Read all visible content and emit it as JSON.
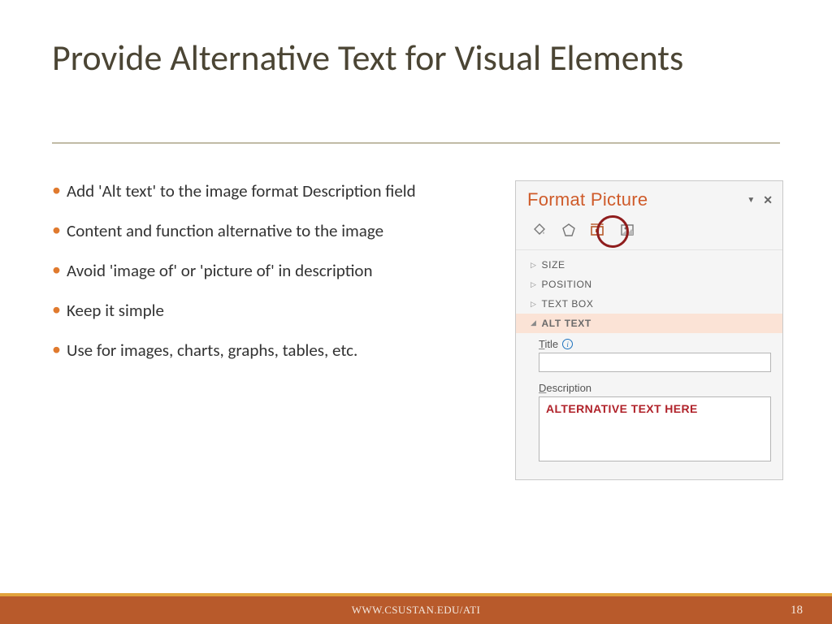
{
  "title": "Provide Alternative Text for Visual Elements",
  "bullets": [
    "Add 'Alt text' to the image format Description field",
    "Content and function alternative to the image",
    "Avoid 'image of' or 'picture of' in description",
    "Keep it simple",
    "Use for images, charts, graphs, tables, etc."
  ],
  "panel": {
    "title": "Format Picture",
    "sections": {
      "size": "SIZE",
      "position": "POSITION",
      "textbox": "TEXT BOX",
      "alttext": "ALT TEXT"
    },
    "title_label": "Title",
    "desc_label": "Description",
    "desc_value": "ALTERNATIVE TEXT HERE"
  },
  "footer": {
    "url": "WWW.CSUSTAN.EDU/ATI",
    "page": "18"
  }
}
